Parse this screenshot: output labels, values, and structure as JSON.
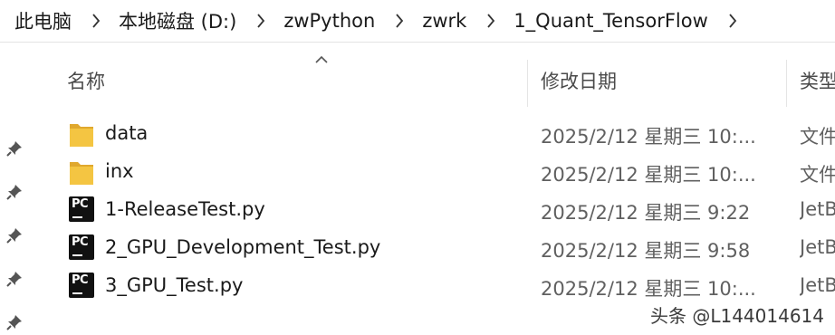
{
  "breadcrumb": [
    "此电脑",
    "本地磁盘 (D:)",
    "zwPython",
    "zwrk",
    "1_Quant_TensorFlow"
  ],
  "columns": {
    "name": "名称",
    "date": "修改日期",
    "type": "类型"
  },
  "files": [
    {
      "name": "data",
      "date": "2025/2/12 星期三 10:...",
      "type": "文件",
      "icon": "folder-icon"
    },
    {
      "name": "inx",
      "date": "2025/2/12 星期三 10:...",
      "type": "文件",
      "icon": "folder-icon"
    },
    {
      "name": "1-ReleaseTest.py",
      "date": "2025/2/12 星期三 9:22",
      "type": "JetB",
      "icon": "pycharm-file-icon"
    },
    {
      "name": "2_GPU_Development_Test.py",
      "date": "2025/2/12 星期三 9:58",
      "type": "JetB",
      "icon": "pycharm-file-icon"
    },
    {
      "name": "3_GPU_Test.py",
      "date": "2025/2/12 星期三 10:...",
      "type": "JetB",
      "icon": "pycharm-file-icon"
    }
  ],
  "watermark": "头条 @L144014614",
  "colors": {
    "folder": "#f4c542",
    "folder_dark": "#e0a82e",
    "pycharm_bg": "#111111"
  }
}
